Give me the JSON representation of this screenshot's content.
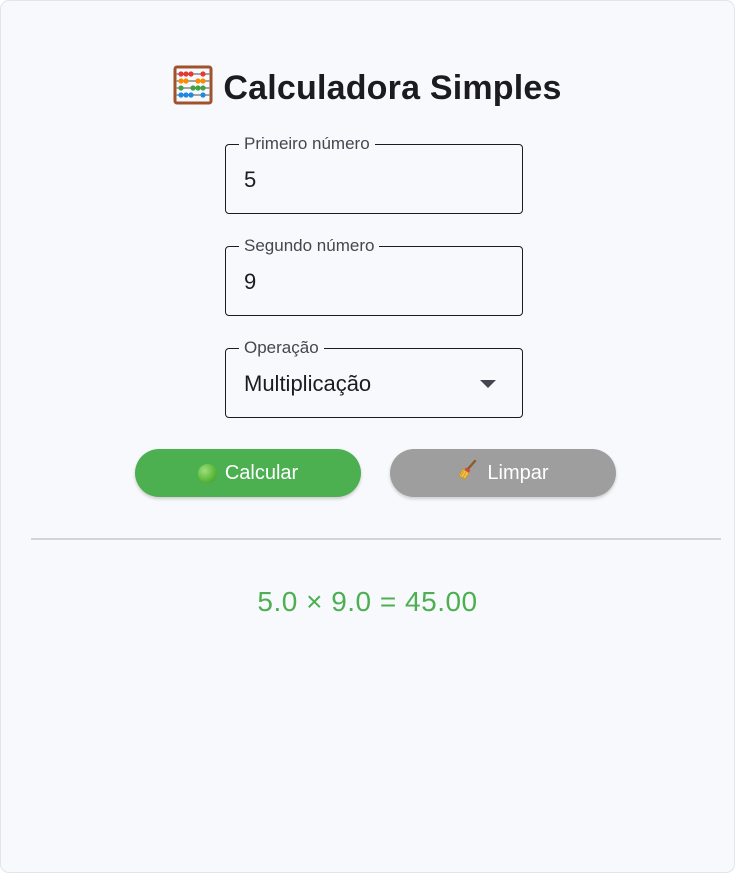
{
  "app": {
    "title": "Calculadora Simples",
    "title_icon": "abacus-icon"
  },
  "form": {
    "first": {
      "label": "Primeiro número",
      "value": "5"
    },
    "second": {
      "label": "Segundo número",
      "value": "9"
    },
    "operation": {
      "label": "Operação",
      "selected": "Multiplicação"
    }
  },
  "buttons": {
    "calculate": {
      "label": "Calcular",
      "icon": "green-circle-icon",
      "color": "#4caf50"
    },
    "clear": {
      "label": "Limpar",
      "icon": "broom-icon",
      "color": "#9e9e9e"
    }
  },
  "result": {
    "text": "5.0 × 9.0 = 45.00",
    "color": "#4caf50"
  }
}
